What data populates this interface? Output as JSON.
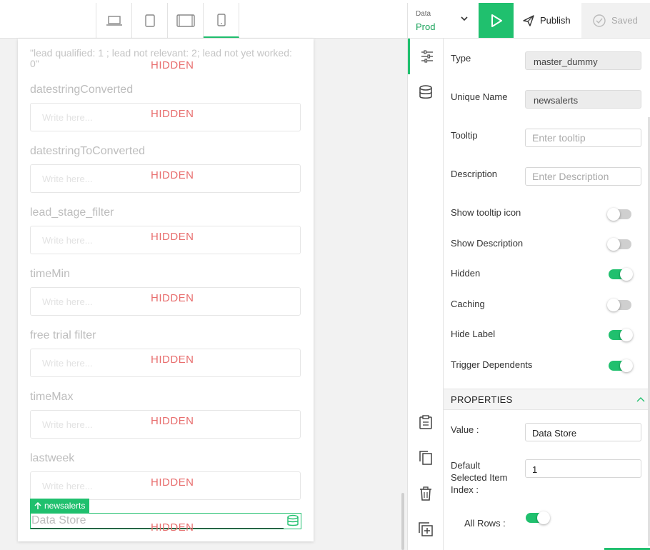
{
  "topbar": {
    "device_icons": [
      "laptop-icon",
      "tablet-icon",
      "tablet-landscape-icon",
      "mobile-icon"
    ],
    "active_device": "mobile-icon",
    "env_label": "Data",
    "env_value": "Prod",
    "publish_label": "Publish",
    "saved_label": "Saved"
  },
  "canvas": {
    "note": "\"lead qualified: 1 ; lead not relevant: 2; lead not yet worked: 0\"",
    "hidden_label": "HIDDEN",
    "placeholder": "Write here...",
    "fields": [
      {
        "label": "datestringConverted"
      },
      {
        "label": "datestringToConverted"
      },
      {
        "label": "lead_stage_filter"
      },
      {
        "label": "timeMin"
      },
      {
        "label": "free trial filter"
      },
      {
        "label": "timeMax"
      },
      {
        "label": "lastweek"
      }
    ],
    "selected": {
      "tag": "newsalerts",
      "label": "Data Store"
    }
  },
  "sidebar_icons": [
    "sliders-icon",
    "database-icon",
    "clipboard-icon",
    "copy-icon",
    "trash-icon",
    "add-square-icon"
  ],
  "panel": {
    "type_label": "Type",
    "type_value": "master_dummy",
    "unique_name_label": "Unique Name",
    "unique_name_value": "newsalerts",
    "tooltip_label": "Tooltip",
    "tooltip_placeholder": "Enter tooltip",
    "description_label": "Description",
    "description_placeholder": "Enter Description",
    "toggles": [
      {
        "label": "Show tooltip icon",
        "on": false
      },
      {
        "label": "Show Description",
        "on": false
      },
      {
        "label": "Hidden",
        "on": true
      },
      {
        "label": "Caching",
        "on": false
      },
      {
        "label": "Hide Label",
        "on": true
      },
      {
        "label": "Trigger Dependents",
        "on": true
      }
    ],
    "properties_title": "PROPERTIES",
    "value_label": "Value :",
    "value_value": "Data Store",
    "default_index_label_1": "Default",
    "default_index_label_2": "Selected Item",
    "default_index_label_3": "Index :",
    "default_index_value": "1",
    "all_rows_label": "All Rows :",
    "all_rows_on": true
  },
  "colors": {
    "accent": "#20c06e",
    "hidden_text": "#e86e6e"
  }
}
